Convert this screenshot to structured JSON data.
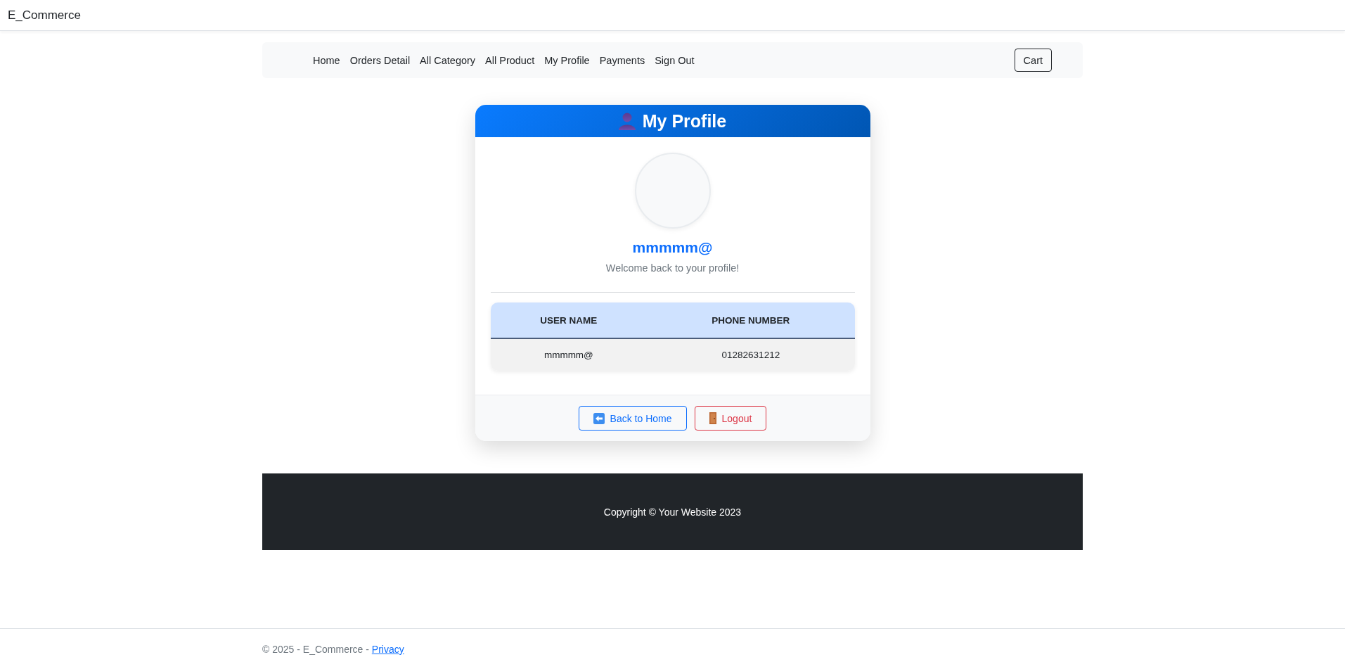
{
  "app_bar": {
    "brand": "E_Commerce"
  },
  "nav": {
    "links": [
      {
        "label": "Home"
      },
      {
        "label": "Orders Detail"
      },
      {
        "label": "All Category"
      },
      {
        "label": "All Product"
      },
      {
        "label": "My Profile"
      },
      {
        "label": "Payments"
      },
      {
        "label": "Sign Out"
      }
    ],
    "cart_button": "Cart"
  },
  "profile_card": {
    "title": "My Profile",
    "username": "mmmmm@",
    "welcome": "Welcome back to your profile!",
    "table": {
      "columns": [
        "USER NAME",
        "PHONE NUMBER"
      ],
      "rows": [
        [
          "mmmmm@",
          "01282631212"
        ]
      ]
    },
    "buttons": [
      {
        "kind": "back",
        "label": "Back to Home"
      },
      {
        "kind": "logout",
        "label": "Logout"
      }
    ]
  },
  "dark_footer": {
    "text": "Copyright © Your Website 2023"
  },
  "page_footer": {
    "text": "© 2025 - E_Commerce -",
    "link": "Privacy"
  }
}
